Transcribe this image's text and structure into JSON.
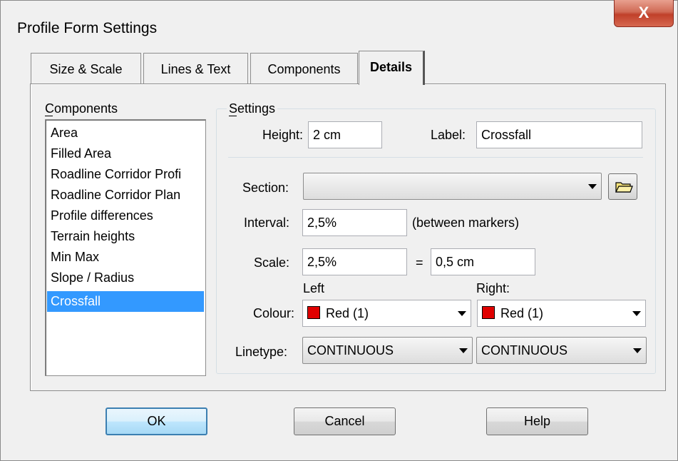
{
  "window": {
    "title": "Profile Form Settings",
    "close_glyph": "X"
  },
  "tabs": [
    {
      "label": "Size & Scale",
      "active": false
    },
    {
      "label": "Lines & Text",
      "active": false
    },
    {
      "label": "Components",
      "active": false
    },
    {
      "label": "Details",
      "active": true
    }
  ],
  "components": {
    "label": "Components",
    "items": [
      "Area",
      "Filled Area",
      "Roadline Corridor Profi",
      "Roadline Corridor Plan",
      "Profile differences",
      "Terrain heights",
      "Min Max",
      "Slope / Radius",
      "Crossfall"
    ],
    "selected": "Crossfall"
  },
  "settings": {
    "label": "Settings",
    "height_label": "Height:",
    "height_value": "2 cm",
    "label_label": "Label:",
    "label_value": "Crossfall",
    "section_label": "Section:",
    "section_value": "",
    "folder_icon": "folder-open-icon",
    "interval_label": "Interval:",
    "interval_value": "2,5%",
    "interval_note": "(between markers)",
    "scale_label": "Scale:",
    "scale_value": "2,5%",
    "scale_equals": "=",
    "scale_result": "0,5 cm",
    "left_header": "Left",
    "right_header": "Right:",
    "colour_label": "Colour:",
    "colour_left": "Red (1)",
    "colour_right": "Red (1)",
    "colour_swatch": "#e00000",
    "linetype_label": "Linetype:",
    "linetype_left": "CONTINUOUS",
    "linetype_right": "CONTINUOUS"
  },
  "buttons": {
    "ok": "OK",
    "cancel": "Cancel",
    "help": "Help"
  }
}
